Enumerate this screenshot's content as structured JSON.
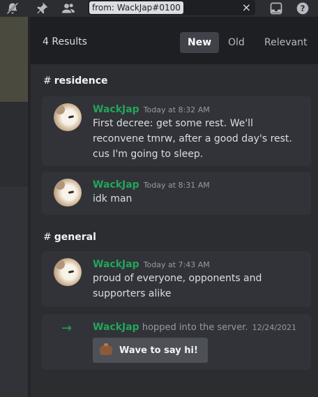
{
  "toolbar": {
    "icons": [
      "muted-bell-icon",
      "pin-icon",
      "members-icon",
      "inbox-icon",
      "help-icon"
    ]
  },
  "search": {
    "query": "from: WackJap#0100",
    "clear": "×"
  },
  "results": {
    "count_label": "4 Results",
    "sort_tabs": [
      {
        "label": "New",
        "active": true
      },
      {
        "label": "Old",
        "active": false
      },
      {
        "label": "Relevant",
        "active": false
      }
    ]
  },
  "groups": [
    {
      "channel": "residence",
      "messages": [
        {
          "author": "WackJap",
          "time": "Today at 8:32 AM",
          "text": "First decree: get some rest. We'll reconvene tmrw, after a good day's rest. cus I'm going to sleep."
        },
        {
          "author": "WackJap",
          "time": "Today at 8:31 AM",
          "text": "idk man"
        }
      ]
    },
    {
      "channel": "general",
      "messages": [
        {
          "author": "WackJap",
          "time": "Today at 7:43 AM",
          "text": "proud of everyone, opponents and supporters alike"
        }
      ]
    }
  ],
  "join": {
    "author": "WackJap",
    "text": "hopped into the server.",
    "date": "12/24/2021",
    "button": "Wave to say hi!"
  },
  "colors": {
    "author": "#23a55a",
    "accent_bg": "#2b2d31"
  }
}
